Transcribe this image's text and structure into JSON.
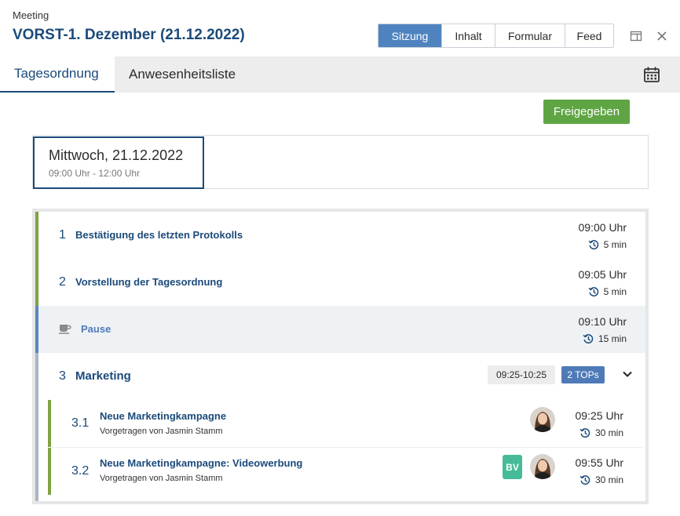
{
  "header": {
    "app_label": "Meeting",
    "title": "VORST-1. Dezember (21.12.2022)",
    "segments": [
      {
        "label": "Sitzung",
        "active": true
      },
      {
        "label": "Inhalt",
        "active": false
      },
      {
        "label": "Formular",
        "active": false
      },
      {
        "label": "Feed",
        "active": false
      }
    ]
  },
  "tabs": [
    {
      "label": "Tagesordnung",
      "active": true
    },
    {
      "label": "Anwesenheitsliste",
      "active": false
    }
  ],
  "approve_label": "Freigegeben",
  "date_card": {
    "date": "Mittwoch, 21.12.2022",
    "hours": "09:00 Uhr - 12:00 Uhr"
  },
  "agenda": {
    "items": [
      {
        "num": "1",
        "title": "Bestätigung des letzten Protokolls",
        "time": "09:00 Uhr",
        "duration": "5 min"
      },
      {
        "num": "2",
        "title": "Vorstellung der Tagesordnung",
        "time": "09:05 Uhr",
        "duration": "5 min"
      }
    ],
    "pause": {
      "title": "Pause",
      "time": "09:10 Uhr",
      "duration": "15 min"
    },
    "group": {
      "num": "3",
      "title": "Marketing",
      "range": "09:25-10:25",
      "tops": "2 TOPs",
      "subitems": [
        {
          "num": "3.1",
          "title": "Neue Marketingkampagne",
          "by": "Vorgetragen von  Jasmin Stamm",
          "time": "09:25 Uhr",
          "duration": "30 min"
        },
        {
          "num": "3.2",
          "title": "Neue Marketingkampagne: Videowerbung",
          "by": "Vorgetragen von  Jasmin Stamm",
          "time": "09:55 Uhr",
          "duration": "30 min",
          "badge": "BV"
        }
      ]
    }
  },
  "colors": {
    "primary": "#1b4a7a",
    "active_segment": "#4f83c0",
    "approve": "#5fa544",
    "item_bar": "#7ea342",
    "pause_bar": "#5a86c0",
    "group_bar": "#a9b6c3",
    "badge_bv": "#45bb97"
  }
}
